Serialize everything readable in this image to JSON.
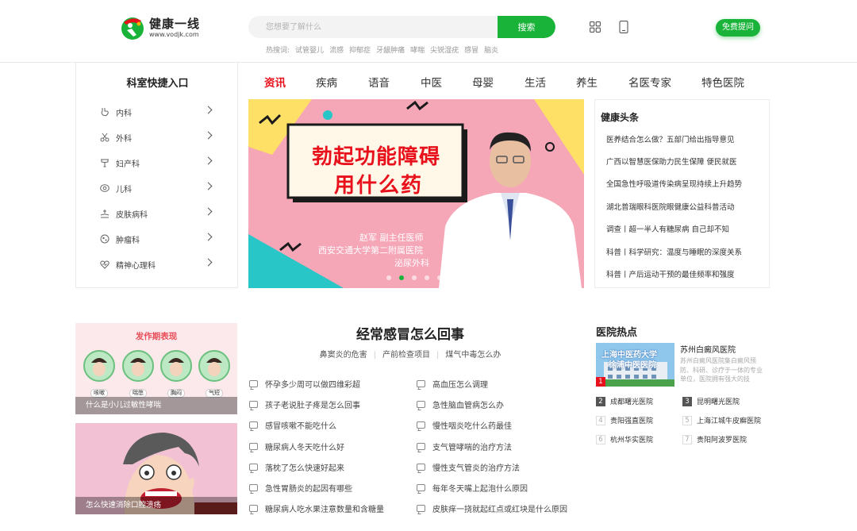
{
  "header": {
    "logo_title": "健康一线",
    "logo_url": "www.vodjk.com",
    "search_placeholder": "您想要了解什么",
    "search_button": "搜索",
    "hot_label": "热搜词:",
    "hot_words": [
      "试管婴儿",
      "流感",
      "抑郁症",
      "牙龈肿痛",
      "哮喘",
      "尖锐湿疣",
      "感冒",
      "脑炎"
    ],
    "ask_button": "免费提问",
    "icons": [
      "grid-icon",
      "mobile-icon"
    ]
  },
  "departments": {
    "title": "科室快捷入口",
    "items": [
      {
        "label": "内科",
        "icon": "stomach-icon"
      },
      {
        "label": "外科",
        "icon": "scissors-icon"
      },
      {
        "label": "妇产科",
        "icon": "uterus-icon"
      },
      {
        "label": "儿科",
        "icon": "baby-icon"
      },
      {
        "label": "皮肤病科",
        "icon": "skin-icon"
      },
      {
        "label": "肿瘤科",
        "icon": "tumor-icon"
      },
      {
        "label": "精神心理科",
        "icon": "heart-pulse-icon"
      }
    ]
  },
  "nav": {
    "items": [
      "资讯",
      "疾病",
      "语音",
      "中医",
      "母婴",
      "生活",
      "养生",
      "名医专家",
      "特色医院"
    ],
    "active_index": 0
  },
  "banner": {
    "headline_line1": "勃起功能障碍",
    "headline_line2": "用什么药",
    "doctor_line1": "赵军  副主任医师",
    "doctor_line2": "西安交通大学第二附属医院",
    "doctor_line3": "泌尿外科",
    "dot_count": 5,
    "active_dot": 1
  },
  "headlines": {
    "title": "健康头条",
    "items": [
      "医养结合怎么做？五部门给出指导意见",
      "广西以智慧医保助力民生保障 便民就医",
      "全国急性呼吸道传染病呈现持续上升趋势",
      "湖北普瑞眼科医院眼健康公益科普活动",
      "调查丨超一半人有糖尿病 自己却不知",
      "科普丨科学研究：温度与睡眠的深度关系",
      "科普丨产后运动干预的最佳频率和强度"
    ]
  },
  "cards": [
    {
      "title": "发作期表现",
      "labels": [
        "咳嗽",
        "喘憋",
        "胸闷",
        "气短"
      ],
      "caption": "什么是小儿过敏性哮喘"
    },
    {
      "caption": "怎么快速消除口腔溃疡"
    }
  ],
  "article": {
    "title": "经常感冒怎么回事",
    "tags": [
      "鼻窦炎的危害",
      "产前检查项目",
      "煤气中毒怎么办"
    ],
    "left": [
      "怀孕多少周可以做四维彩超",
      "孩子老说肚子疼是怎么回事",
      "感冒咳嗽不能吃什么",
      "糖尿病人冬天吃什么好",
      "落枕了怎么快速好起来",
      "急性胃肠炎的起因有哪些",
      "糖尿病人吃水果注意数量和含糖量"
    ],
    "right": [
      "高血压怎么调理",
      "急性脑血管病怎么办",
      "慢性咽炎吃什么药最佳",
      "支气管哮喘的治疗方法",
      "慢性支气管炎的治疗方法",
      "每年冬天嘴上起泡什么原因",
      "皮肤痒一挠就起红点或红块是什么原因"
    ]
  },
  "hospitals": {
    "title": "医院热点",
    "featured_name": "苏州白癜风医院",
    "featured_desc": "苏州白癜风医院集白癜风预防、科研、诊疗于一体的专业单位，医院拥有强大的技",
    "featured_image_text_1": "上海中医药大学",
    "featured_image_text_2": "徐浦中医医院",
    "featured_rank": "1",
    "list": [
      {
        "no": "2",
        "name": "成都曙光医院"
      },
      {
        "no": "3",
        "name": "昆明曙光医院"
      },
      {
        "no": "4",
        "name": "贵阳强直医院"
      },
      {
        "no": "5",
        "name": "上海江城牛皮癣医院"
      },
      {
        "no": "6",
        "name": "杭州华实医院"
      },
      {
        "no": "7",
        "name": "贵阳阿波罗医院"
      }
    ]
  },
  "colors": {
    "brand_green": "#19b33a",
    "nav_active": "#e8111b",
    "banner_pink": "#f5a6b7",
    "banner_yellow": "#ffe066",
    "banner_teal": "#28c6c6"
  }
}
